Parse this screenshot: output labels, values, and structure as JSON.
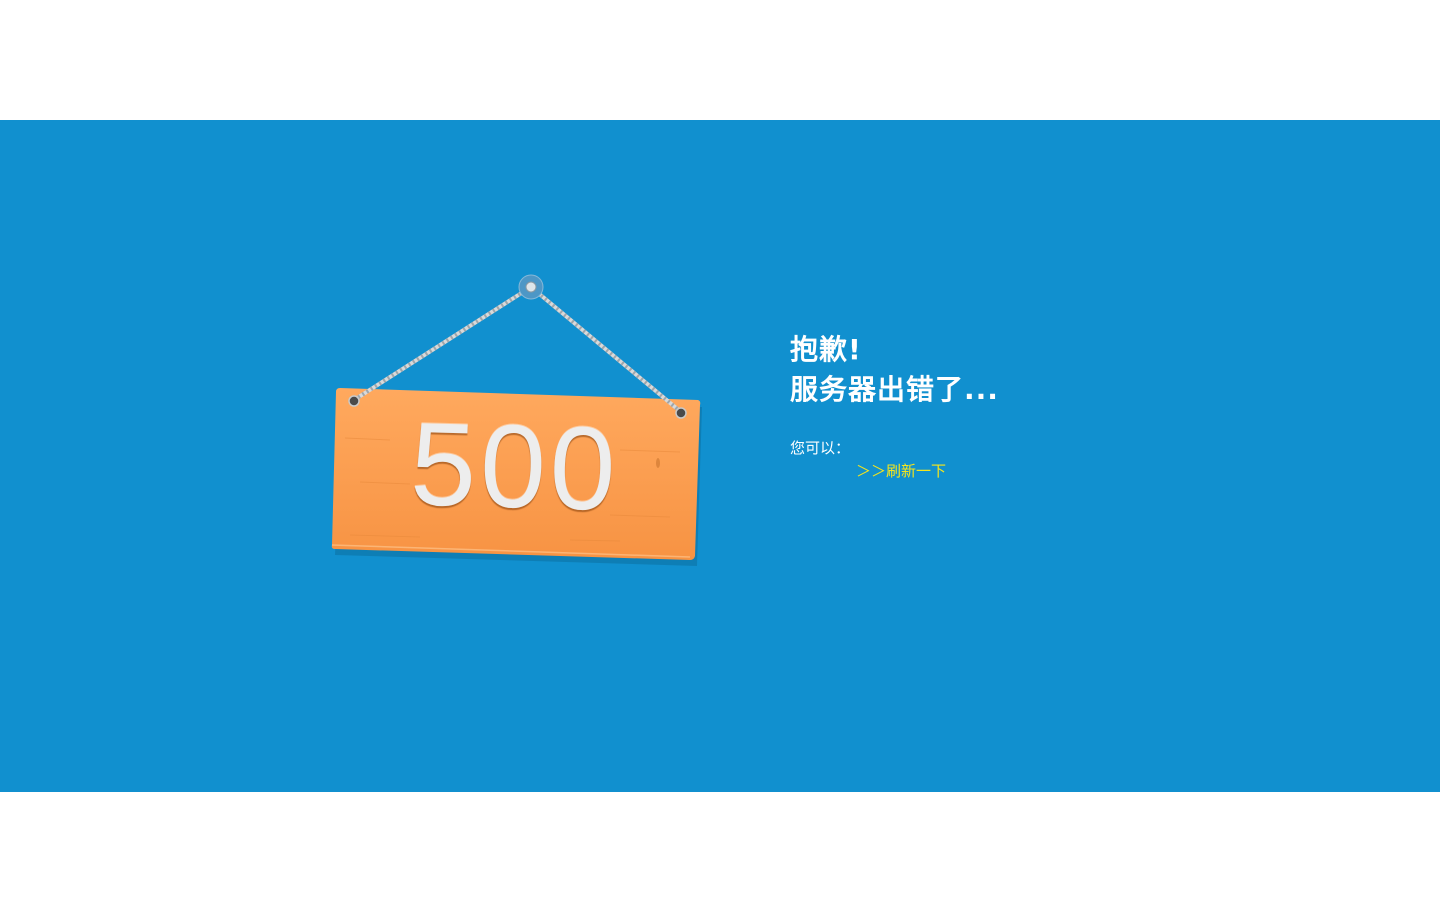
{
  "error_sign": {
    "code": "500"
  },
  "message": {
    "line1": "抱歉!",
    "line2": "服务器出错了..."
  },
  "options": {
    "label": "您可以：",
    "refresh_link": "＞＞刷新一下"
  },
  "colors": {
    "banner": "#1190cf",
    "sign": "#fc9a4e",
    "link": "#f5e51c",
    "text": "#ffffff"
  }
}
